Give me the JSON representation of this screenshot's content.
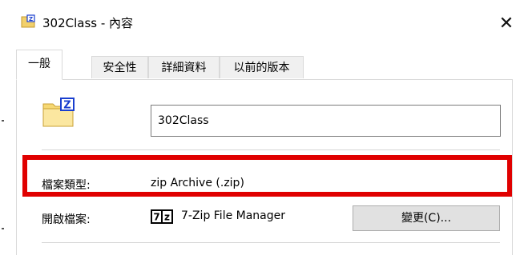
{
  "window": {
    "title": "302Class - 內容",
    "close_glyph": "✕",
    "title_icon": "zip-folder-icon"
  },
  "tabs": [
    {
      "label": "一般",
      "active": true
    },
    {
      "label": "安全性",
      "active": false
    },
    {
      "label": "詳細資料",
      "active": false
    },
    {
      "label": "以前的版本",
      "active": false
    }
  ],
  "general": {
    "file_icon": "zip-folder-icon",
    "name_value": "302Class",
    "file_type_label": "檔案類型:",
    "file_type_value": "zip Archive (.zip)",
    "opens_with_label": "開啟檔案:",
    "opens_with_icon": "7zip-icon",
    "opens_with_value": "7-Zip File Manager",
    "change_button_label": "變更(C)..."
  },
  "colors": {
    "highlight": "#e00000",
    "button_bg": "#e1e1e1",
    "tab_bg": "#f0f0f0"
  }
}
